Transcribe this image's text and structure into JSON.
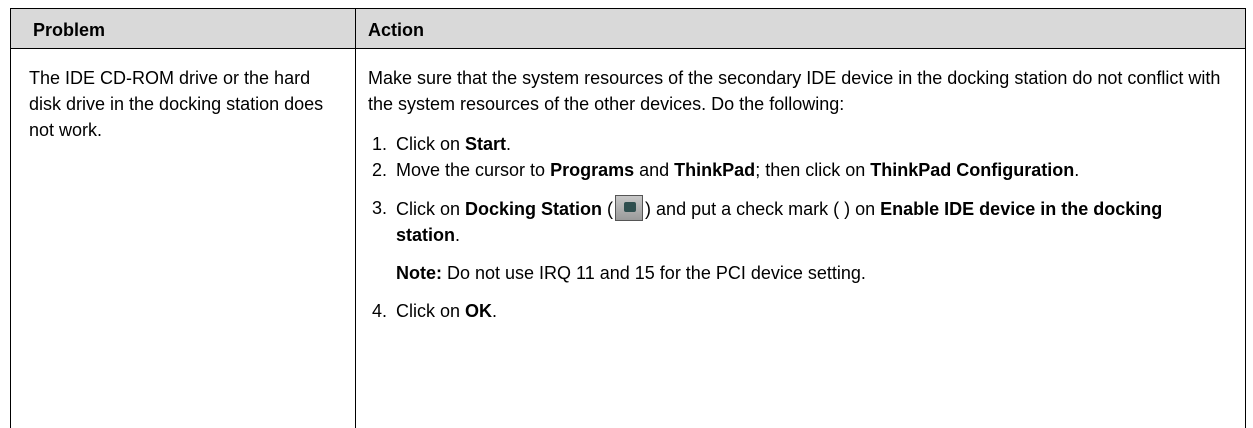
{
  "headers": {
    "problem": "Problem",
    "action": "Action"
  },
  "problem_text": "The IDE CD-ROM drive or the hard disk drive in the docking station does not work.",
  "intro_text": "Make sure that the system resources of the secondary IDE device in the docking station do not conflict with the system resources of the other devices. Do the following:",
  "steps": {
    "s1": {
      "num": "1.",
      "t1": "Click on ",
      "b1": "Start",
      "t2": "."
    },
    "s2": {
      "num": "2.",
      "t1": "Move the cursor to ",
      "b1": "Programs",
      "t2": " and ",
      "b2": "ThinkPad",
      "t3": "; then click on ",
      "b3": "ThinkPad Configuration",
      "t4": "."
    },
    "s3": {
      "num": "3.",
      "t1": "Click on ",
      "b1": "Docking Station",
      "t2": " (",
      "t3": ") and put a check mark (  ) on ",
      "b2": "Enable IDE device in the docking station",
      "t4": "."
    },
    "note": {
      "label": "Note:",
      "text": "  Do not use IRQ 11 and 15 for the PCI device setting."
    },
    "s4": {
      "num": "4.",
      "t1": "Click on ",
      "b1": "OK",
      "t2": "."
    }
  },
  "icons": {
    "docking_station": "docking-station-icon"
  }
}
